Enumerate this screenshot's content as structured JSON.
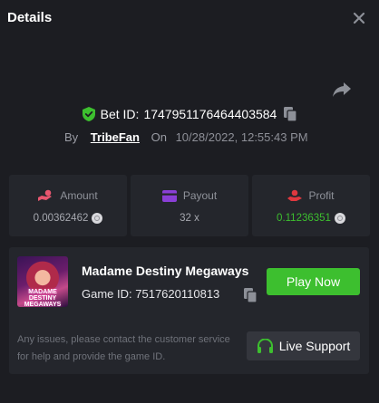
{
  "header": {
    "title": "Details"
  },
  "bet": {
    "label": "Bet ID:",
    "id": "1747951176464403584",
    "by_label": "By",
    "user": "TribeFan",
    "on_label": "On",
    "datetime": "10/28/2022, 12:55:43 PM"
  },
  "stats": [
    {
      "label": "Amount",
      "value": "0.00362462",
      "icon": "hand-coin-icon",
      "color": "#e8566f"
    },
    {
      "label": "Payout",
      "value": "32 x",
      "icon": "card-icon",
      "color": "#8a3fd6"
    },
    {
      "label": "Profit",
      "value": "0.11236351",
      "icon": "profit-icon",
      "color": "#e0383f",
      "value_color": "#3dbf2f"
    }
  ],
  "game": {
    "name": "Madame Destiny Megaways",
    "id_label": "Game ID:",
    "id": "7517620110813",
    "thumb_text": "MADAME DESTINY MEGAWAYS",
    "play_label": "Play Now",
    "help_text": "Any issues, please contact the customer service for help and provide the game ID.",
    "support_label": "Live Support"
  },
  "colors": {
    "accent_green": "#3dbf2f",
    "background": "#1c1d22",
    "card": "#24262c"
  }
}
